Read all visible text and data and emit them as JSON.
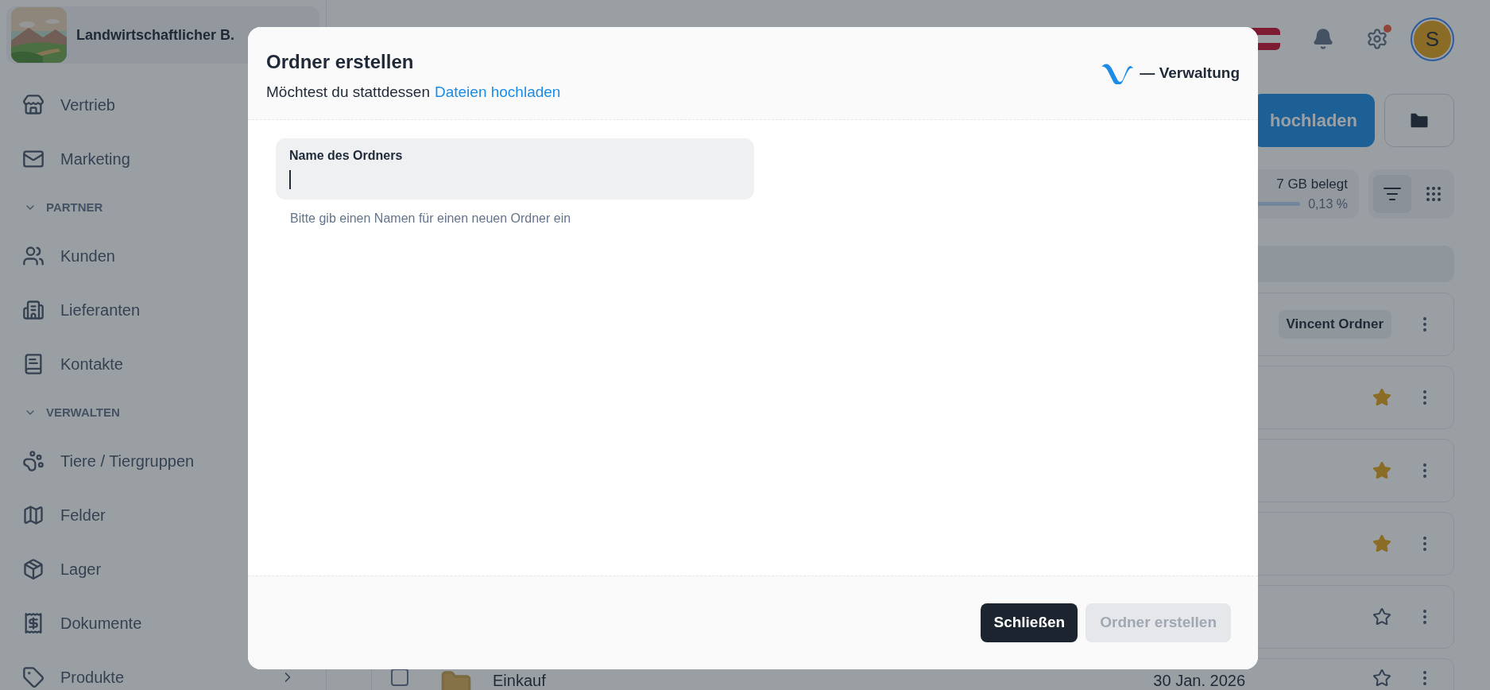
{
  "header": {
    "company": "Landwirtschaftlicher B.",
    "avatar": "S",
    "settings_alert": true
  },
  "sidebar": {
    "items": [
      {
        "kind": "item",
        "label": "Vertrieb"
      },
      {
        "kind": "item",
        "label": "Marketing"
      },
      {
        "kind": "section",
        "label": "PARTNER",
        "expanded": true
      },
      {
        "kind": "item",
        "label": "Kunden"
      },
      {
        "kind": "item",
        "label": "Lieferanten"
      },
      {
        "kind": "item",
        "label": "Kontakte"
      },
      {
        "kind": "section",
        "label": "VERWALTEN",
        "expanded": true
      },
      {
        "kind": "item",
        "label": "Tiere / Tiergruppen"
      },
      {
        "kind": "item",
        "label": "Felder"
      },
      {
        "kind": "item",
        "label": "Lager"
      },
      {
        "kind": "item",
        "label": "Dokumente"
      },
      {
        "kind": "item",
        "label": "Produkte",
        "has_submenu": true
      }
    ]
  },
  "toolbar": {
    "upload_button": "hochladen",
    "storage": "7 GB belegt",
    "storage_percent": "0,13 %"
  },
  "rows": [
    {
      "tag": "Vincent Ordner"
    },
    {
      "starred": true
    },
    {
      "starred": true
    },
    {
      "starred": true
    },
    {
      "starred": false
    },
    {
      "name": "Einkauf",
      "date": "30 Jan. 2026",
      "starred": false,
      "checked": false
    }
  ],
  "dialog": {
    "title": "Ordner erstellen",
    "subtitle": "Möchtest du stattdessen",
    "link": "Dateien hochladen",
    "brand": "— Verwaltung",
    "field": {
      "label": "Name des Ordners",
      "focused": true
    },
    "helper": "Bitte gib einen Namen für einen neuen Ordner ein",
    "buttons": [
      {
        "label": "Schließen",
        "disabled": false
      },
      {
        "label": "Ordner erstellen",
        "disabled": true
      }
    ]
  }
}
